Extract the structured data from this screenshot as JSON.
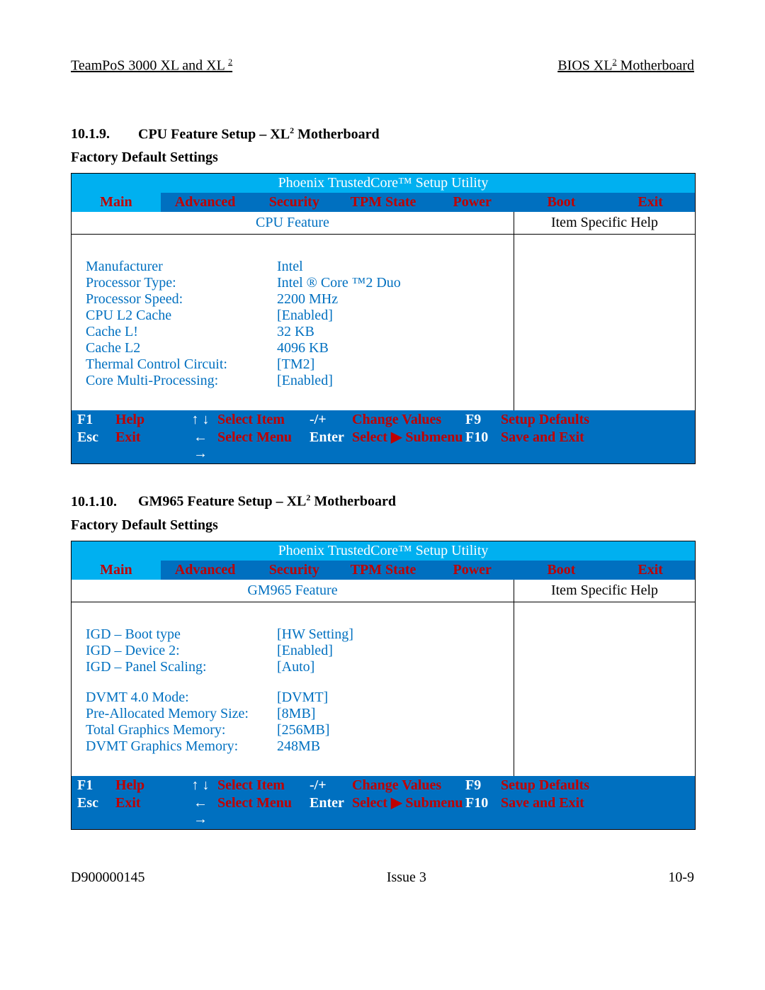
{
  "header": {
    "left": "TeamPoS 3000 XL and XL",
    "left_sup": "2",
    "right_pre": "BIOS XL",
    "right_sup": "2",
    "right_post": " Motherboard"
  },
  "section1": {
    "num": "10.1.9.",
    "title_pre": "CPU Feature Setup – XL",
    "title_sup": "2",
    "title_post": " Motherboard",
    "sub": "Factory Default Settings",
    "utility_title": "Phoenix TrustedCore™ Setup Utility",
    "tabs": [
      "Main",
      "Advanced",
      "Security",
      "TPM State",
      "Power",
      "Boot",
      "Exit"
    ],
    "left_title": "CPU Feature",
    "right_title": "Item Specific Help",
    "rows": [
      {
        "label": "Manufacturer",
        "value": "Intel"
      },
      {
        "label": "Processor Type:",
        "value": "Intel ® Core ™2 Duo"
      },
      {
        "label": "Processor Speed:",
        "value": "2200 MHz"
      },
      {
        "label": "CPU L2 Cache",
        "value": "[Enabled]"
      },
      {
        "label": "Cache L!",
        "value": "32 KB"
      },
      {
        "label": "Cache L2",
        "value": "4096 KB"
      },
      {
        "label": "Thermal Control Circuit:",
        "value": "[TM2]"
      },
      {
        "label": "Core Multi-Processing:",
        "value": "[Enabled]"
      }
    ]
  },
  "section2": {
    "num": "10.1.10.",
    "title_pre": "GM965 Feature Setup – XL",
    "title_sup": "2",
    "title_post": " Motherboard",
    "sub": "Factory Default Settings",
    "utility_title": "Phoenix TrustedCore™ Setup Utility",
    "tabs": [
      "Main",
      "Advanced",
      "Security",
      "TPM State",
      "Power",
      "Boot",
      "Exit"
    ],
    "left_title": "GM965 Feature",
    "right_title": "Item Specific Help",
    "rows1": [
      {
        "label": "IGD – Boot type",
        "value": "[HW Setting]"
      },
      {
        "label": "IGD – Device 2:",
        "value": "[Enabled]"
      },
      {
        "label": "IGD – Panel Scaling:",
        "value": "[Auto]"
      }
    ],
    "rows2": [
      {
        "label": "DVMT 4.0 Mode:",
        "value": "[DVMT]"
      },
      {
        "label": "Pre-Allocated Memory Size:",
        "value": "[8MB]"
      },
      {
        "label": "Total Graphics Memory:",
        "value": "[256MB]"
      },
      {
        "label": "DVMT Graphics Memory:",
        "value": "248MB"
      }
    ]
  },
  "footer_keys": {
    "f1": "F1",
    "help": "Help",
    "arrows_v": "↑ ↓",
    "select_item": "Select Item",
    "pm": "-/+",
    "change": "Change Values",
    "f9": "F9",
    "setup": "Setup Defaults",
    "esc": "Esc",
    "exit": "Exit",
    "arrows_h": "← →",
    "select_menu": "Select Menu",
    "enter": "Enter",
    "submenu": "Select ▶ Submenu",
    "f10": "F10",
    "save": "Save and Exit"
  },
  "page_footer": {
    "left": "D900000145",
    "center": "Issue 3",
    "right": "10-9"
  }
}
